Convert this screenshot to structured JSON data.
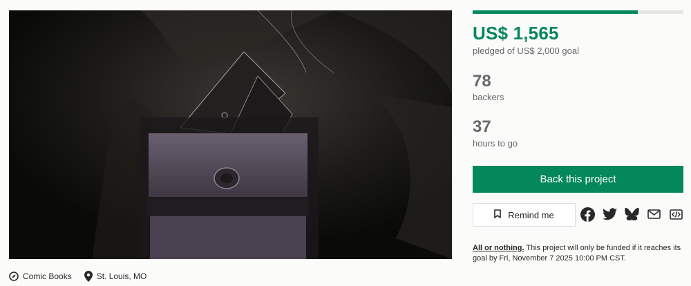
{
  "hero": {
    "image_description": "project-hero-image"
  },
  "meta": {
    "category": "Comic Books",
    "location": "St. Louis, MO"
  },
  "stats": {
    "progress_fraction": 0.7825,
    "pledged_amount": "US$ 1,565",
    "pledged_label": "pledged of US$ 2,000 goal",
    "backers_count": "78",
    "backers_label": "backers",
    "time_left": "37",
    "time_left_label": "hours to go"
  },
  "actions": {
    "back_label": "Back this project",
    "remind_label": "Remind me"
  },
  "share": [
    "facebook-icon",
    "twitter-icon",
    "bluesky-icon",
    "email-icon",
    "embed-icon"
  ],
  "funding": {
    "link_text": "All or nothing.",
    "text": " This project will only be funded if it reaches its goal by Fri, November 7 2025 10:00 PM CST."
  },
  "colors": {
    "accent": "#05875c",
    "muted": "#656969",
    "track": "#e5e5e3"
  }
}
